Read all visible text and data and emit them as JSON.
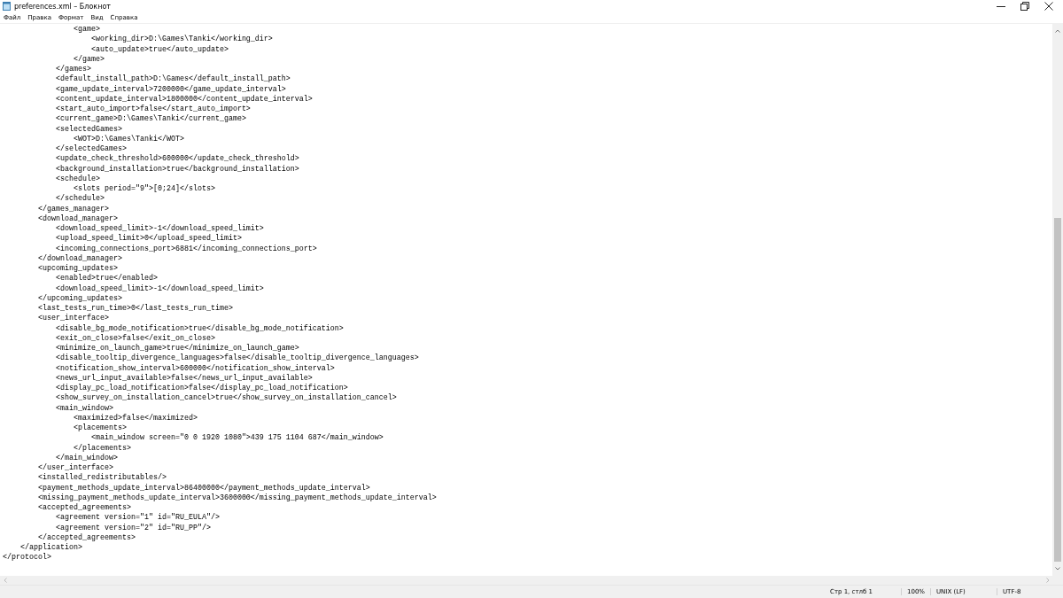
{
  "window": {
    "title": "preferences.xml – Блокнот"
  },
  "menu": [
    "Файл",
    "Правка",
    "Формат",
    "Вид",
    "Справка"
  ],
  "editor": {
    "lines": [
      "                <game>",
      "                    <working_dir>D:\\Games\\Tanki</working_dir>",
      "                    <auto_update>true</auto_update>",
      "                </game>",
      "            </games>",
      "            <default_install_path>D:\\Games</default_install_path>",
      "            <game_update_interval>7200000</game_update_interval>",
      "            <content_update_interval>1800000</content_update_interval>",
      "            <start_auto_import>false</start_auto_import>",
      "            <current_game>D:\\Games\\Tanki</current_game>",
      "            <selectedGames>",
      "                <WOT>D:\\Games\\Tanki</WOT>",
      "            </selectedGames>",
      "            <update_check_threshold>600000</update_check_threshold>",
      "            <background_installation>true</background_installation>",
      "            <schedule>",
      "                <slots period=\"9\">[0;24]</slots>",
      "            </schedule>",
      "        </games_manager>",
      "        <download_manager>",
      "            <download_speed_limit>-1</download_speed_limit>",
      "            <upload_speed_limit>0</upload_speed_limit>",
      "            <incoming_connections_port>6881</incoming_connections_port>",
      "        </download_manager>",
      "        <upcoming_updates>",
      "            <enabled>true</enabled>",
      "            <download_speed_limit>-1</download_speed_limit>",
      "        </upcoming_updates>",
      "        <last_tests_run_time>0</last_tests_run_time>",
      "        <user_interface>",
      "            <disable_bg_mode_notification>true</disable_bg_mode_notification>",
      "            <exit_on_close>false</exit_on_close>",
      "            <minimize_on_launch_game>true</minimize_on_launch_game>",
      "            <disable_tooltip_divergence_languages>false</disable_tooltip_divergence_languages>",
      "            <notification_show_interval>600000</notification_show_interval>",
      "            <news_url_input_available>false</news_url_input_available>",
      "            <display_pc_load_notification>false</display_pc_load_notification>",
      "            <show_survey_on_installation_cancel>true</show_survey_on_installation_cancel>",
      "            <main_window>",
      "                <maximized>false</maximized>",
      "                <placements>",
      "                    <main_window screen=\"0 0 1920 1080\">439 175 1104 687</main_window>",
      "                </placements>",
      "            </main_window>",
      "        </user_interface>",
      "        <installed_redistributables/>",
      "        <payment_methods_update_interval>86400000</payment_methods_update_interval>",
      "        <missing_payment_methods_update_interval>3600000</missing_payment_methods_update_interval>",
      "        <accepted_agreements>",
      "            <agreement version=\"1\" id=\"RU_EULA\"/>",
      "            <agreement version=\"2\" id=\"RU_PP\"/>",
      "        </accepted_agreements>",
      "    </application>",
      "</protocol>"
    ]
  },
  "status_bar": [
    "Стр 1, стлб 1",
    "100%",
    "UNIX (LF)",
    "UTF-8"
  ]
}
